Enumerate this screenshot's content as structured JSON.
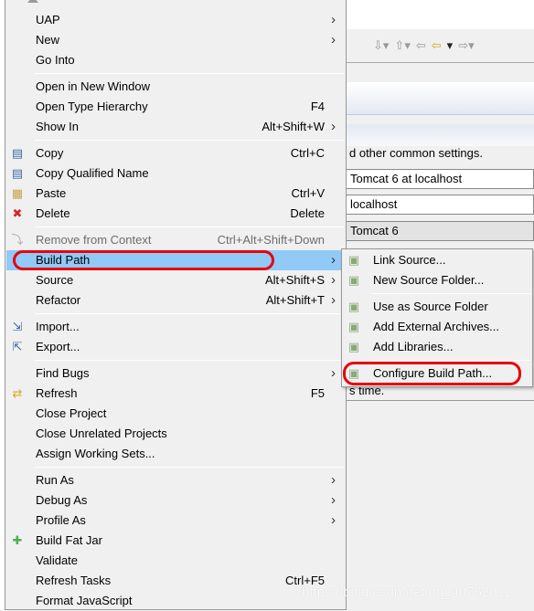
{
  "background": {
    "description_line": "d other common settings.",
    "server_name": "Tomcat 6 at localhost",
    "host_name": "localhost",
    "runtime": "Tomcat 6",
    "note": "s time."
  },
  "context_menu": {
    "items": [
      {
        "label": "UAP",
        "submenu": true
      },
      {
        "label": "New",
        "submenu": true
      },
      {
        "label": "Go Into"
      },
      {
        "label": "Open in New Window"
      },
      {
        "label": "Open Type Hierarchy",
        "shortcut": "F4"
      },
      {
        "label": "Show In",
        "shortcut": "Alt+Shift+W",
        "submenu": true
      },
      {
        "label": "Copy",
        "shortcut": "Ctrl+C",
        "icon": "copy-icon"
      },
      {
        "label": "Copy Qualified Name",
        "icon": "copy-qualified-name-icon"
      },
      {
        "label": "Paste",
        "shortcut": "Ctrl+V",
        "icon": "paste-icon"
      },
      {
        "label": "Delete",
        "shortcut": "Delete",
        "icon": "delete-icon"
      },
      {
        "label": "Remove from Context",
        "shortcut": "Ctrl+Alt+Shift+Down",
        "disabled": true,
        "icon": "remove-context-icon"
      },
      {
        "label": "Build Path",
        "submenu": true,
        "highlighted": true
      },
      {
        "label": "Source",
        "shortcut": "Alt+Shift+S",
        "submenu": true
      },
      {
        "label": "Refactor",
        "shortcut": "Alt+Shift+T",
        "submenu": true
      },
      {
        "label": "Import...",
        "icon": "import-icon"
      },
      {
        "label": "Export...",
        "icon": "export-icon"
      },
      {
        "label": "Find Bugs",
        "submenu": true
      },
      {
        "label": "Refresh",
        "shortcut": "F5",
        "icon": "refresh-icon"
      },
      {
        "label": "Close Project"
      },
      {
        "label": "Close Unrelated Projects"
      },
      {
        "label": "Assign Working Sets..."
      },
      {
        "label": "Run As",
        "submenu": true
      },
      {
        "label": "Debug As",
        "submenu": true
      },
      {
        "label": "Profile As",
        "submenu": true
      },
      {
        "label": "Build Fat Jar",
        "icon": "plus-icon"
      },
      {
        "label": "Validate"
      },
      {
        "label": "Refresh Tasks",
        "shortcut": "Ctrl+F5"
      },
      {
        "label": "Format JavaScript"
      }
    ]
  },
  "build_path_submenu": {
    "items": [
      {
        "label": "Link Source..."
      },
      {
        "label": "New Source Folder..."
      },
      {
        "label": "Use as Source Folder"
      },
      {
        "label": "Add External Archives..."
      },
      {
        "label": "Add Libraries..."
      },
      {
        "label": "Configure Build Path...",
        "annotated": true
      }
    ]
  },
  "annotation_color": "#e8000a",
  "highlight_color": "#91c9f7",
  "watermark": "https://blog.csdn.net/qq_40762011"
}
